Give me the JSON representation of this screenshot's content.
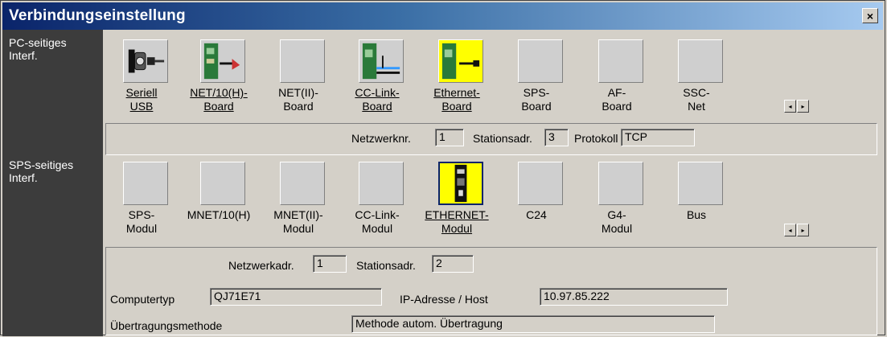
{
  "window": {
    "title": "Verbindungseinstellung",
    "close_glyph": "×"
  },
  "pc_side": {
    "label": "PC-seitiges\nInterf.",
    "items": [
      {
        "label": "Seriell\nUSB",
        "icon": "serial-usb-icon",
        "underlined": true
      },
      {
        "label": "NET/10(H)-\nBoard",
        "icon": "net10-board-icon",
        "underlined": true
      },
      {
        "label": "NET(II)-\nBoard",
        "icon": "blank-icon",
        "underlined": false
      },
      {
        "label": "CC-Link-\nBoard",
        "icon": "cc-link-board-icon",
        "underlined": true
      },
      {
        "label": "Ethernet-\nBoard",
        "icon": "ethernet-board-icon",
        "underlined": true
      },
      {
        "label": "SPS-\nBoard",
        "icon": "blank-icon",
        "underlined": false
      },
      {
        "label": "AF-\nBoard",
        "icon": "blank-icon",
        "underlined": false
      },
      {
        "label": "SSC-\nNet",
        "icon": "blank-icon",
        "underlined": false
      }
    ],
    "settings": {
      "netzwerknr_label": "Netzwerknr.",
      "netzwerknr_value": "1",
      "stationsadr_label": "Stationsadr.",
      "stationsadr_value": "3",
      "protokoll_label": "Protokoll",
      "protokoll_value": "TCP"
    }
  },
  "sps_side": {
    "label": "SPS-seitiges\nInterf.",
    "items": [
      {
        "label": "SPS-\nModul",
        "icon": "blank-icon",
        "underlined": false
      },
      {
        "label": "MNET/10(H)",
        "icon": "blank-icon",
        "underlined": false
      },
      {
        "label": "MNET(II)-\nModul",
        "icon": "blank-icon",
        "underlined": false
      },
      {
        "label": "CC-Link-\nModul",
        "icon": "blank-icon",
        "underlined": false
      },
      {
        "label": "ETHERNET-\nModul",
        "icon": "ethernet-module-icon",
        "underlined": true
      },
      {
        "label": "C24",
        "icon": "blank-icon",
        "underlined": false
      },
      {
        "label": "G4-\nModul",
        "icon": "blank-icon",
        "underlined": false
      },
      {
        "label": "Bus",
        "icon": "blank-icon",
        "underlined": false
      }
    ],
    "settings": {
      "netzwerkadr_label": "Netzwerkadr.",
      "netzwerkadr_value": "1",
      "stationsadr_label": "Stationsadr.",
      "stationsadr_value": "2",
      "computertyp_label": "Computertyp",
      "computertyp_value": "QJ71E71",
      "ip_label": "IP-Adresse / Host",
      "ip_value": "10.97.85.222",
      "method_label": "Übertragungsmethode",
      "method_value": "Methode autom. Übertragung"
    }
  },
  "scroll": {
    "left_glyph": "◂",
    "right_glyph": "▸"
  },
  "colors": {
    "title_start": "#0a246a",
    "title_end": "#a6caf0",
    "side_band": "#3c3c3c",
    "face": "#d4d0c8",
    "yellow": "#ffff00"
  }
}
